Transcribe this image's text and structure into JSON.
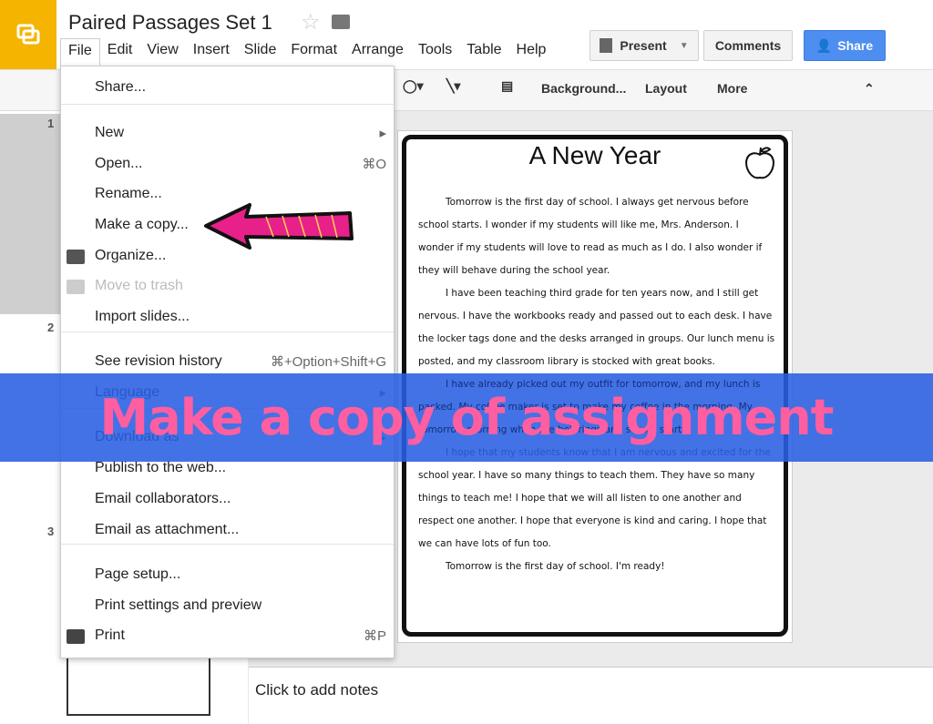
{
  "app": {
    "title": "Paired Passages Set 1",
    "icons": {
      "logo": "slides-logo",
      "star": "star-icon",
      "folder": "folder-icon"
    }
  },
  "menubar": [
    "File",
    "Edit",
    "View",
    "Insert",
    "Slide",
    "Format",
    "Arrange",
    "Tools",
    "Table",
    "Help"
  ],
  "buttons": {
    "present": "Present",
    "comments": "Comments",
    "share": "Share"
  },
  "toolbar": {
    "background": "Background...",
    "layout": "Layout",
    "more": "More"
  },
  "slides": {
    "numbers": [
      "1",
      "2",
      "3"
    ]
  },
  "file_menu": [
    {
      "label": "Share...",
      "shortcut": ""
    },
    {
      "label": "New",
      "shortcut": "▸"
    },
    {
      "label": "Open...",
      "shortcut": "⌘O"
    },
    {
      "label": "Rename...",
      "shortcut": ""
    },
    {
      "label": "Make a copy...",
      "shortcut": ""
    },
    {
      "label": "Organize...",
      "shortcut": ""
    },
    {
      "label": "Move to trash",
      "shortcut": "",
      "disabled": true
    },
    {
      "label": "Import slides...",
      "shortcut": ""
    },
    {
      "label": "See revision history",
      "shortcut": "⌘+Option+Shift+G"
    },
    {
      "label": "Language",
      "shortcut": "▸"
    },
    {
      "label": "Download as",
      "shortcut": "▸"
    },
    {
      "label": "Publish to the web...",
      "shortcut": ""
    },
    {
      "label": "Email collaborators...",
      "shortcut": ""
    },
    {
      "label": "Email as attachment...",
      "shortcut": ""
    },
    {
      "label": "Page setup...",
      "shortcut": ""
    },
    {
      "label": "Print settings and preview",
      "shortcut": ""
    },
    {
      "label": "Print",
      "shortcut": "⌘P"
    }
  ],
  "slide": {
    "title": "A New Year",
    "paragraphs": [
      "Tomorrow is the first day of school. I always get nervous before school starts. I wonder if my students will like me, Mrs. Anderson. I wonder if my students will love to read as much as I do. I also wonder if they will behave during the school year.",
      "I have been teaching third grade for ten years now, and I still get nervous. I have the workbooks ready and passed out to each desk. I have the locker tags done and the desks arranged in groups. Our lunch menu is posted, and my classroom library is stocked with great books.",
      "I have already picked out my outfit for tomorrow, and my lunch is packed. My coffee maker is set to make my coffee in the morning. My ... tomorrow morning when the bell rings and school starts.",
      "I hope that my students know that I am nervous and excited for the school year. I have so many things to teach them. They have so many things to teach me! I hope that we will all listen to one another and respect one another. I hope that everyone is kind and caring. I hope that we can have lots of fun too.",
      "Tomorrow is the first day of school. I'm ready!"
    ]
  },
  "notes": {
    "placeholder": "Click to add notes"
  },
  "overlay": {
    "banner": "Make a copy of assignment",
    "arrow": "arrow-left-icon"
  },
  "colors": {
    "brand": "#f4b400",
    "share": "#4d8ef0",
    "banner": "#285fe1",
    "banner_text": "#ff5ea0",
    "arrow": "#e8208a"
  }
}
